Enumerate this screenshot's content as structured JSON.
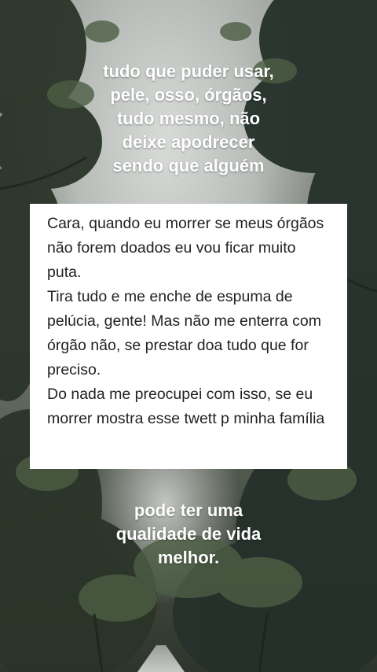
{
  "overlay_caption_top": [
    "tudo que puder usar,",
    "pele, osso, órgãos,",
    "tudo mesmo, não",
    "deixe apodrecer",
    "sendo que alguém"
  ],
  "overlay_caption_bottom": [
    "pode ter uma",
    "qualidade de vida",
    "melhor."
  ],
  "tweet": {
    "paragraph_1": "Cara, quando eu morrer se meus órgãos não forem doados eu vou ficar muito puta.",
    "paragraph_2": "Tira tudo e me enche de espuma de pelúcia, gente! Mas não me enterra com órgão não, se prestar doa tudo que for preciso.",
    "paragraph_3": "Do nada me preocupei com isso, se eu morrer mostra esse twett p minha família"
  },
  "colors": {
    "caption_text": "#ffffff",
    "card_background": "#ffffff",
    "card_text": "#222222"
  }
}
